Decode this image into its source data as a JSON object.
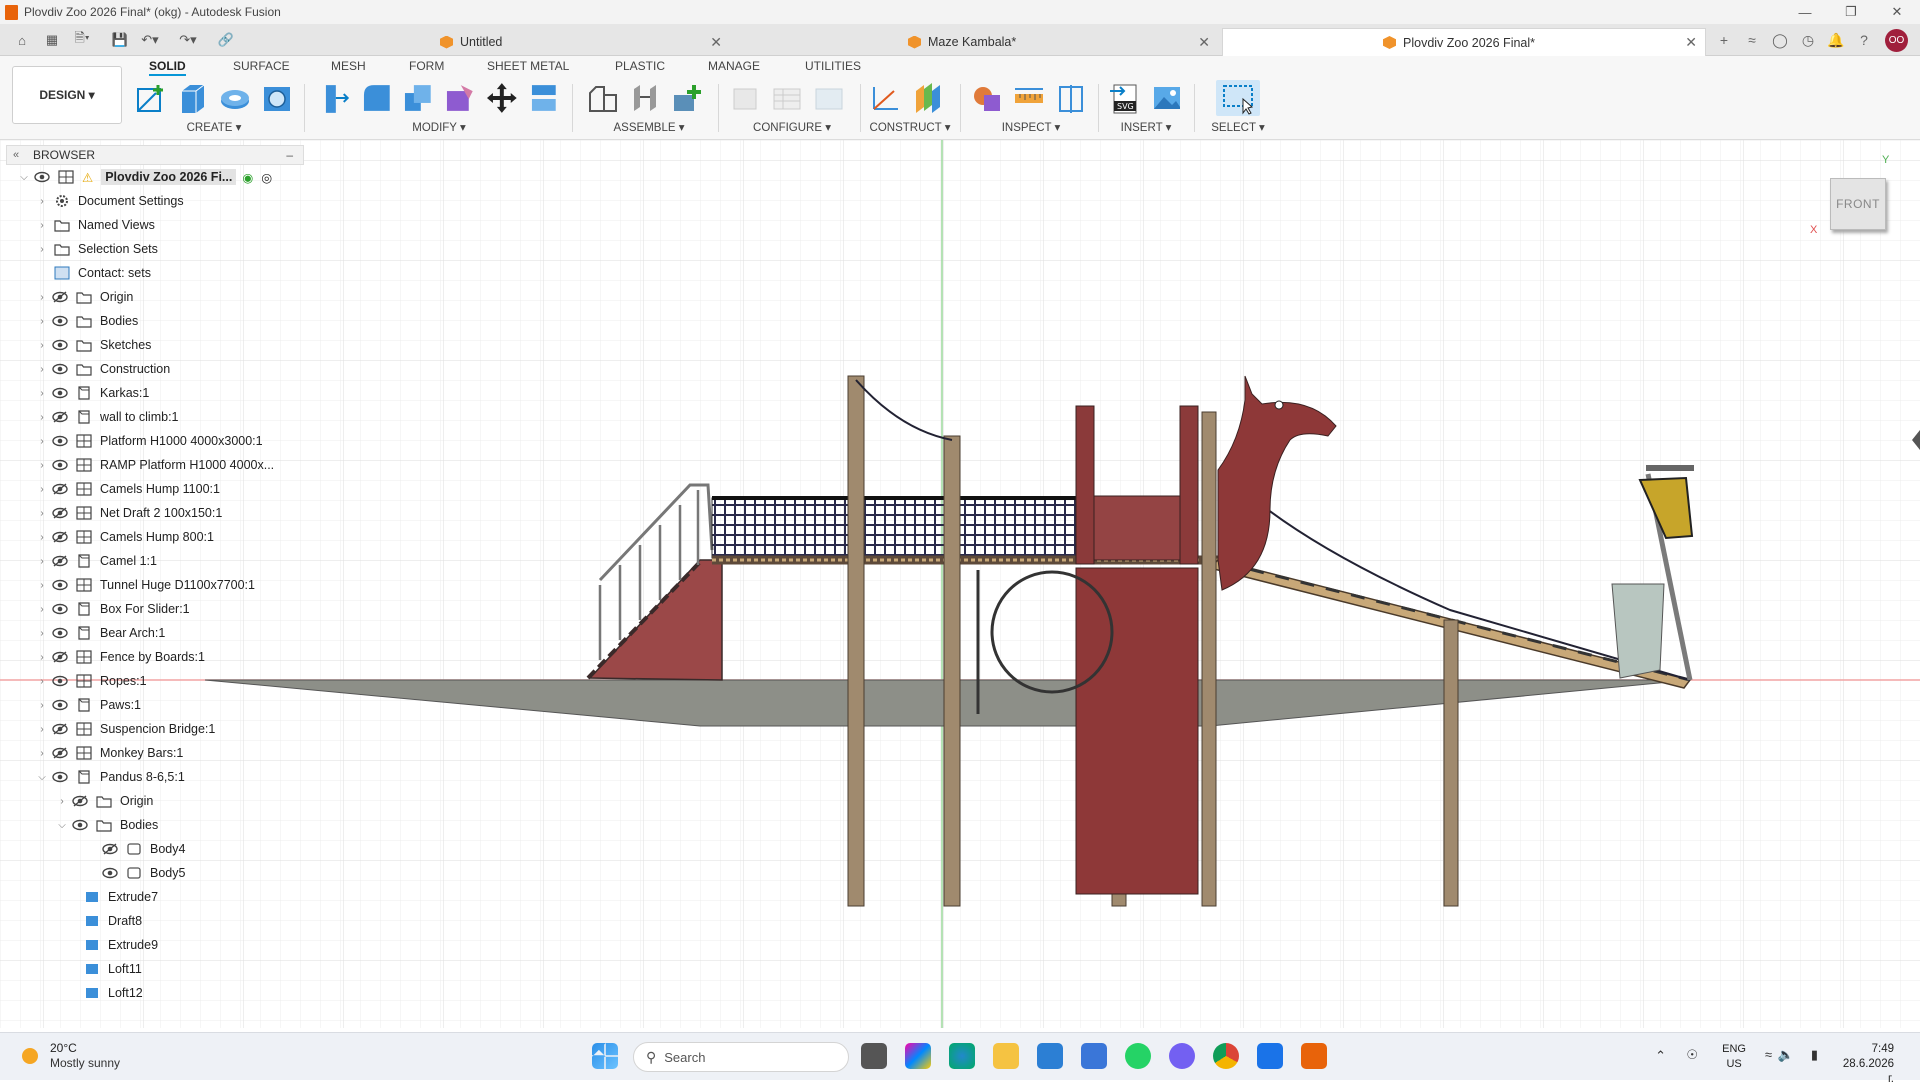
{
  "window": {
    "title": "Plovdiv Zoo 2026 Final* (okg) - Autodesk Fusion"
  },
  "tabs": [
    {
      "label": "Untitled"
    },
    {
      "label": "Maze Kambala*"
    },
    {
      "label": "Plovdiv Zoo 2026 Final*"
    }
  ],
  "user": {
    "initials": "OO"
  },
  "workspace": {
    "label": "DESIGN"
  },
  "ribbon": {
    "tabs": [
      "SOLID",
      "SURFACE",
      "MESH",
      "FORM",
      "SHEET METAL",
      "PLASTIC",
      "MANAGE",
      "UTILITIES"
    ],
    "groups": [
      "CREATE",
      "MODIFY",
      "ASSEMBLE",
      "CONFIGURE",
      "CONSTRUCT",
      "INSPECT",
      "INSERT",
      "SELECT"
    ]
  },
  "browser": {
    "title": "BROWSER",
    "root": "Plovdiv Zoo 2026 Fi...",
    "items": [
      "Document Settings",
      "Named Views",
      "Selection Sets",
      "Contact: sets",
      "Origin",
      "Bodies",
      "Sketches",
      "Construction",
      "Karkas:1",
      "wall to climb:1",
      "Platform H1000 4000x3000:1",
      "RAMP Platform H1000 4000x...",
      "Camels Hump 1100:1",
      "Net Draft 2 100x150:1",
      "Camels Hump 800:1",
      "Camel 1:1",
      "Tunnel Huge  D1100x7700:1",
      "Box For Slider:1",
      "Bear Arch:1",
      "Fence by Boards:1",
      "Ropes:1",
      "Paws:1",
      "Suspencion Bridge:1",
      "Monkey Bars:1",
      "Pandus 8-6,5:1"
    ],
    "sub_items": [
      "Origin",
      "Bodies"
    ],
    "bodies": [
      "Body4",
      "Body5"
    ],
    "features": [
      "Extrude7",
      "Draft8",
      "Extrude9",
      "Loft11",
      "Loft12"
    ]
  },
  "viewcube": {
    "face": "FRONT",
    "axis_x": "X",
    "axis_y": "Y"
  },
  "taskbar": {
    "weather_temp": "20°C",
    "weather_desc": "Mostly sunny",
    "search_placeholder": "Search",
    "lang_top": "ENG",
    "lang_bottom": "US",
    "time": "7:49",
    "date": "28.6.2026 г."
  },
  "colors": {
    "accent": "#0696d7",
    "camel": "#8b3a3a",
    "wood": "#a08a6e",
    "ramp": "#c8a878"
  }
}
